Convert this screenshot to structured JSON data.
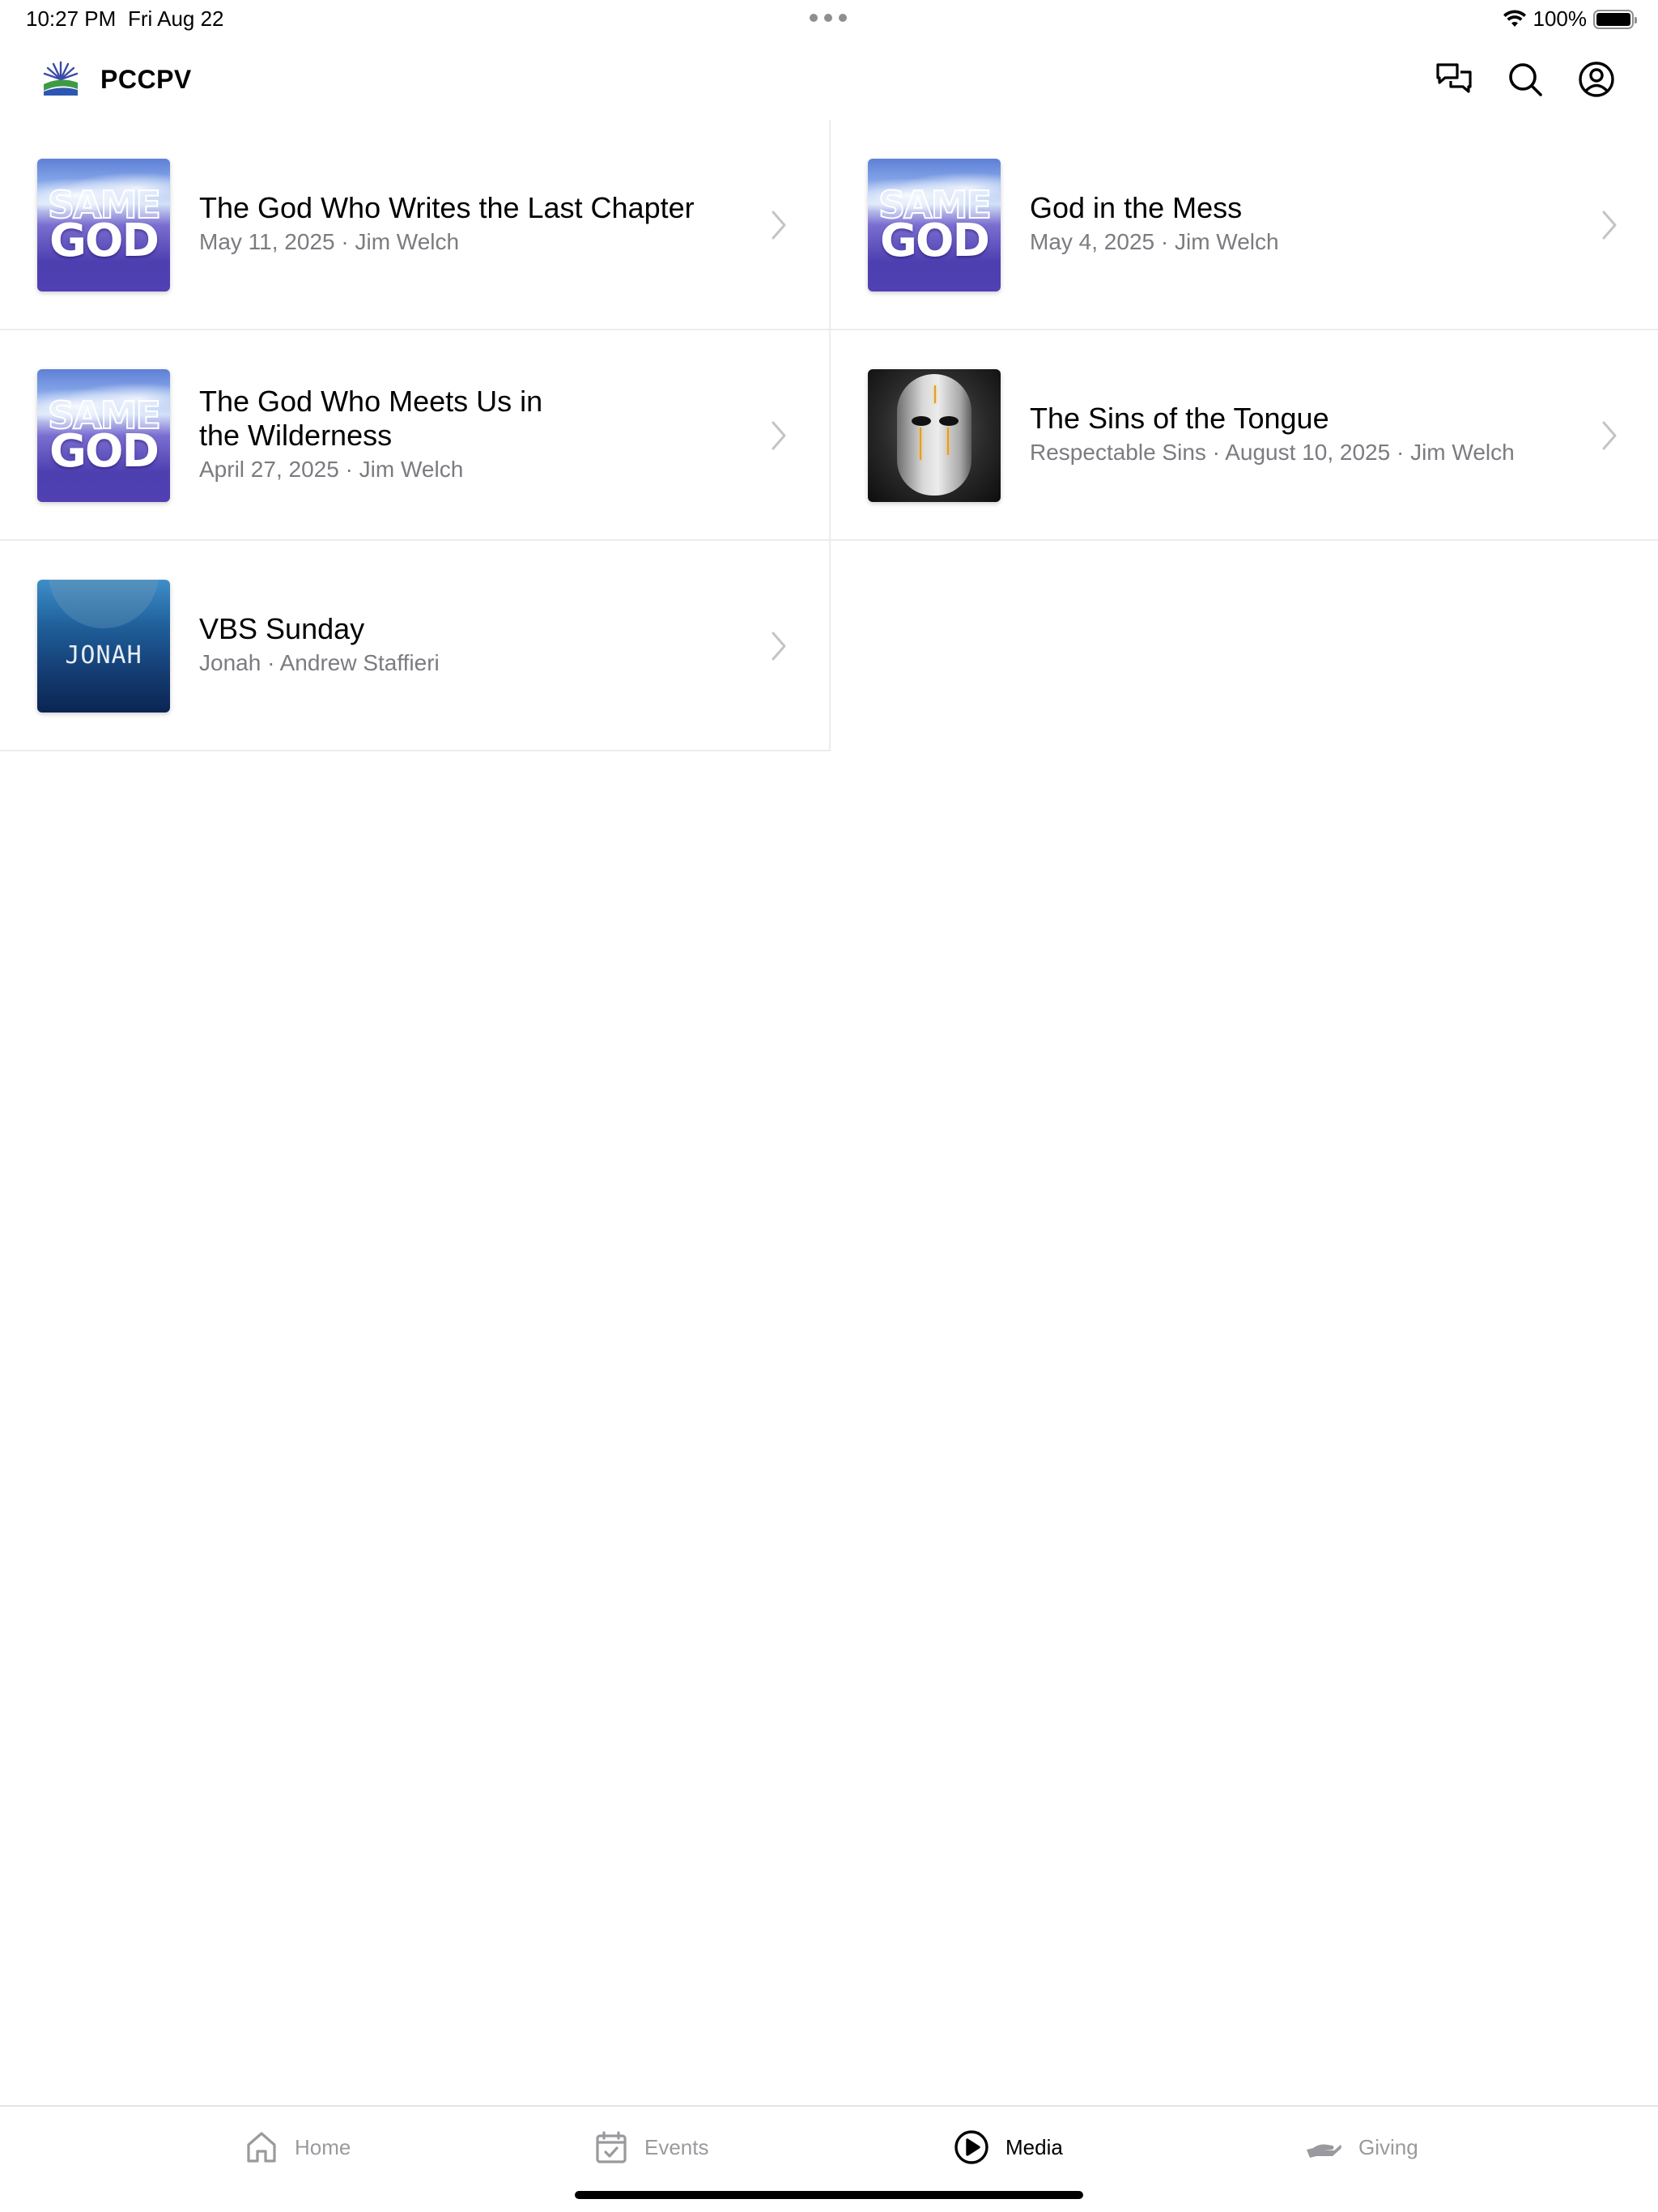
{
  "status_bar": {
    "time": "10:27 PM",
    "date": "Fri Aug 22",
    "battery": "100%"
  },
  "header": {
    "title": "PCCPV",
    "icons": [
      "chat-icon",
      "search-icon",
      "account-icon"
    ]
  },
  "media_items": [
    {
      "title": "The God Who Writes the Last Chapter",
      "subtitle": "May 11, 2025 · Jim Welch",
      "thumbnail": "same-god-series-art",
      "thumbnail_text": [
        "SAME",
        "GOD"
      ]
    },
    {
      "title": "God in the Mess",
      "subtitle": "May 4, 2025 · Jim Welch",
      "thumbnail": "same-god-series-art",
      "thumbnail_text": [
        "SAME",
        "GOD"
      ]
    },
    {
      "title": "The God Who Meets Us in the Wilderness",
      "subtitle": "April 27, 2025 · Jim Welch",
      "thumbnail": "same-god-series-art",
      "thumbnail_text": [
        "SAME",
        "GOD"
      ]
    },
    {
      "title": "The Sins of the Tongue",
      "subtitle": "Respectable Sins · August 10, 2025 · Jim Welch",
      "thumbnail": "cracked-mask-art"
    },
    {
      "title": "VBS Sunday",
      "subtitle": "Jonah · Andrew Staffieri",
      "thumbnail": "jonah-series-art",
      "thumbnail_text": [
        "JONAH"
      ]
    }
  ],
  "tab_bar": {
    "tabs": [
      {
        "label": "Home",
        "icon": "home-icon",
        "active": false
      },
      {
        "label": "Events",
        "icon": "calendar-icon",
        "active": false
      },
      {
        "label": "Media",
        "icon": "play-circle-icon",
        "active": true
      },
      {
        "label": "Giving",
        "icon": "giving-hand-icon",
        "active": false
      }
    ]
  },
  "colors": {
    "active_tab": "#000000",
    "inactive_tab": "#9a9a9e",
    "subtitle": "#7b7b80",
    "divider": "#ececec"
  }
}
